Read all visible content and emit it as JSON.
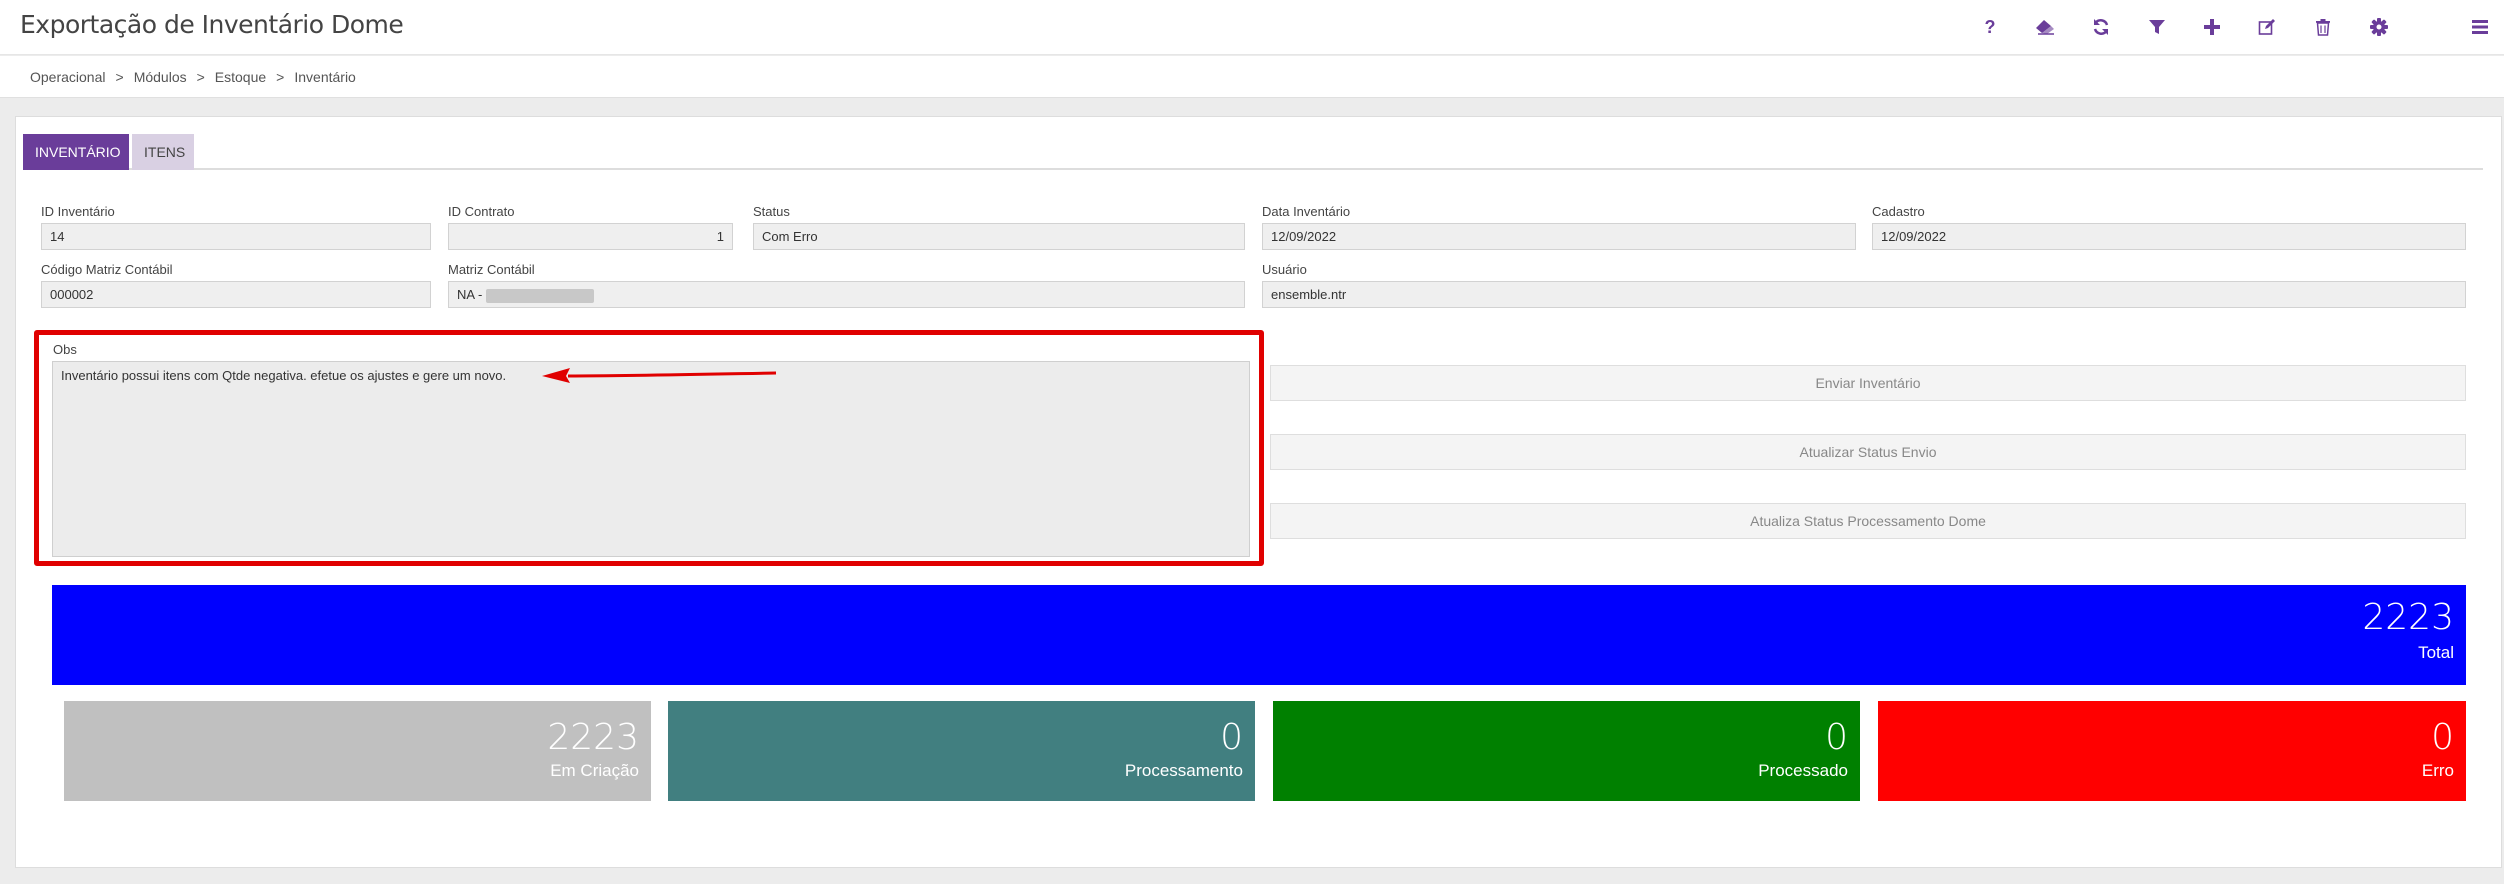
{
  "header": {
    "title": "Exportação de Inventário Dome",
    "help_glyph": "?"
  },
  "breadcrumb": [
    "Operacional",
    "Módulos",
    "Estoque",
    "Inventário"
  ],
  "breadcrumb_sep": ">",
  "tabs": [
    {
      "label": "INVENTÁRIO",
      "active": true
    },
    {
      "label": "ITENS",
      "active": false
    }
  ],
  "fields": {
    "id_inventario": {
      "label": "ID Inventário",
      "value": "14"
    },
    "id_contrato": {
      "label": "ID Contrato",
      "value": "1"
    },
    "status": {
      "label": "Status",
      "value": "Com Erro"
    },
    "data_inventario": {
      "label": "Data Inventário",
      "value": "12/09/2022"
    },
    "cadastro": {
      "label": "Cadastro",
      "value": "12/09/2022"
    },
    "codigo_matriz": {
      "label": "Código Matriz Contábil",
      "value": "000002"
    },
    "matriz_contabil": {
      "label": "Matriz Contábil",
      "value": "NA -"
    },
    "usuario": {
      "label": "Usuário",
      "value": "ensemble.ntr"
    }
  },
  "obs": {
    "label": "Obs",
    "value": "Inventário possui itens com Qtde negativa. efetue os ajustes e gere um novo."
  },
  "actions": {
    "enviar": "Enviar Inventário",
    "atualizar_envio": "Atualizar Status Envio",
    "atualiza_processamento": "Atualiza Status Processamento Dome"
  },
  "stats": {
    "total": {
      "value": "2223",
      "label": "Total",
      "color": "#0000fe"
    },
    "em_criacao": {
      "value": "2223",
      "label": "Em Criação",
      "color": "#c0c0c0"
    },
    "processamento": {
      "value": "0",
      "label": "Processamento",
      "color": "#417f80"
    },
    "processado": {
      "value": "0",
      "label": "Processado",
      "color": "#008000"
    },
    "erro": {
      "value": "0",
      "label": "Erro",
      "color": "#ff0000"
    }
  },
  "colors": {
    "accent": "#6a3d9a",
    "highlight": "#e00000"
  },
  "icons": [
    "help-icon",
    "eraser-icon",
    "refresh-icon",
    "filter-icon",
    "plus-icon",
    "edit-icon",
    "trash-icon",
    "gear-icon",
    "menu-icon"
  ]
}
